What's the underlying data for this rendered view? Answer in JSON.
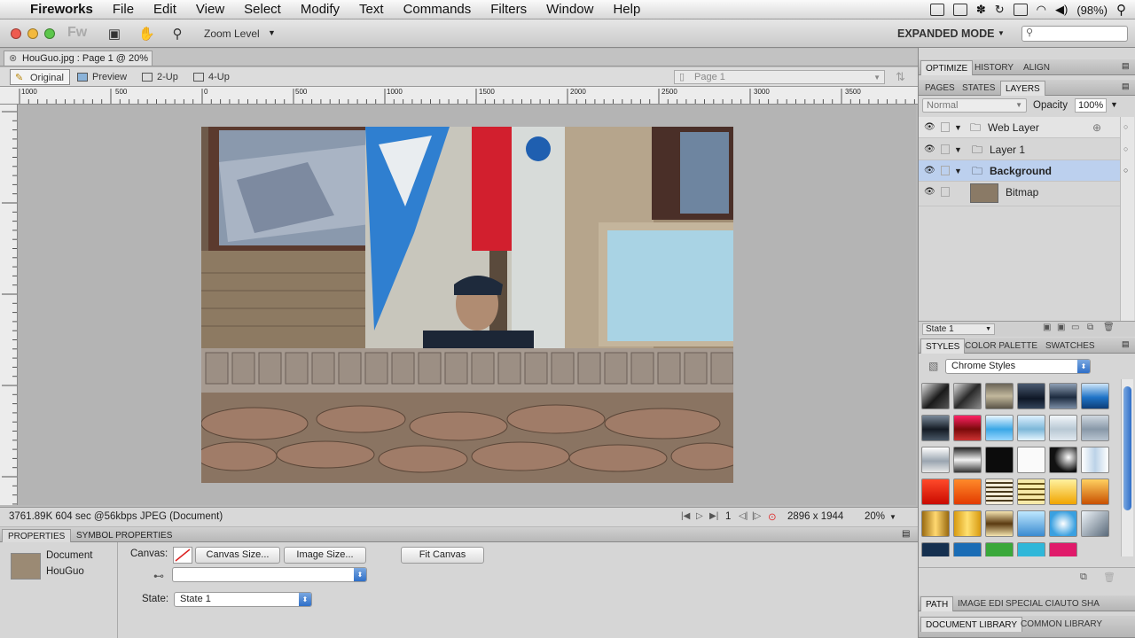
{
  "menubar": {
    "app": "Fireworks",
    "items": [
      "File",
      "Edit",
      "View",
      "Select",
      "Modify",
      "Text",
      "Commands",
      "Filters",
      "Window",
      "Help"
    ],
    "battery": "(98%)"
  },
  "toolbar": {
    "zoom_label": "Zoom Level",
    "mode": "EXPANDED MODE",
    "fw_logo": "Fw"
  },
  "document": {
    "tab_title": "HouGuo.jpg : Page 1 @ 20%",
    "views": [
      "Original",
      "Preview",
      "2-Up",
      "4-Up"
    ],
    "page_select": "Page 1"
  },
  "ruler": {
    "marks": [
      "1000",
      "500",
      "0",
      "500",
      "1000",
      "1500",
      "2000",
      "2500",
      "3000",
      "3500"
    ]
  },
  "status": {
    "info": "3761.89K 604 sec @56kbps JPEG (Document)",
    "frame": "1",
    "dimensions": "2896 x 1944",
    "zoom": "20%"
  },
  "properties": {
    "tabs": [
      "PROPERTIES",
      "SYMBOL PROPERTIES"
    ],
    "doc_type": "Document",
    "doc_name": "HouGuo",
    "canvas_label": "Canvas:",
    "canvas_size": "Canvas Size...",
    "image_size": "Image Size...",
    "fit_canvas": "Fit Canvas",
    "state_label": "State:",
    "state_value": "State 1"
  },
  "panels": {
    "tabs_top": [
      "OPTIMIZE",
      "HISTORY",
      "ALIGN"
    ],
    "tabs_layers": [
      "PAGES",
      "STATES",
      "LAYERS"
    ],
    "blend": "Normal",
    "opacity_label": "Opacity",
    "opacity": "100%",
    "layers": [
      "Web Layer",
      "Layer 1",
      "Background",
      "Bitmap"
    ],
    "state_footer": "State 1",
    "tabs_styles": [
      "STYLES",
      "COLOR PALETTE",
      "SWATCHES"
    ],
    "style_set": "Chrome Styles",
    "tabs_bottom": [
      "PATH",
      "IMAGE EDI",
      "SPECIAL CI",
      "AUTO SHA"
    ],
    "tabs_library": [
      "DOCUMENT LIBRARY",
      "COMMON LIBRARY"
    ]
  }
}
